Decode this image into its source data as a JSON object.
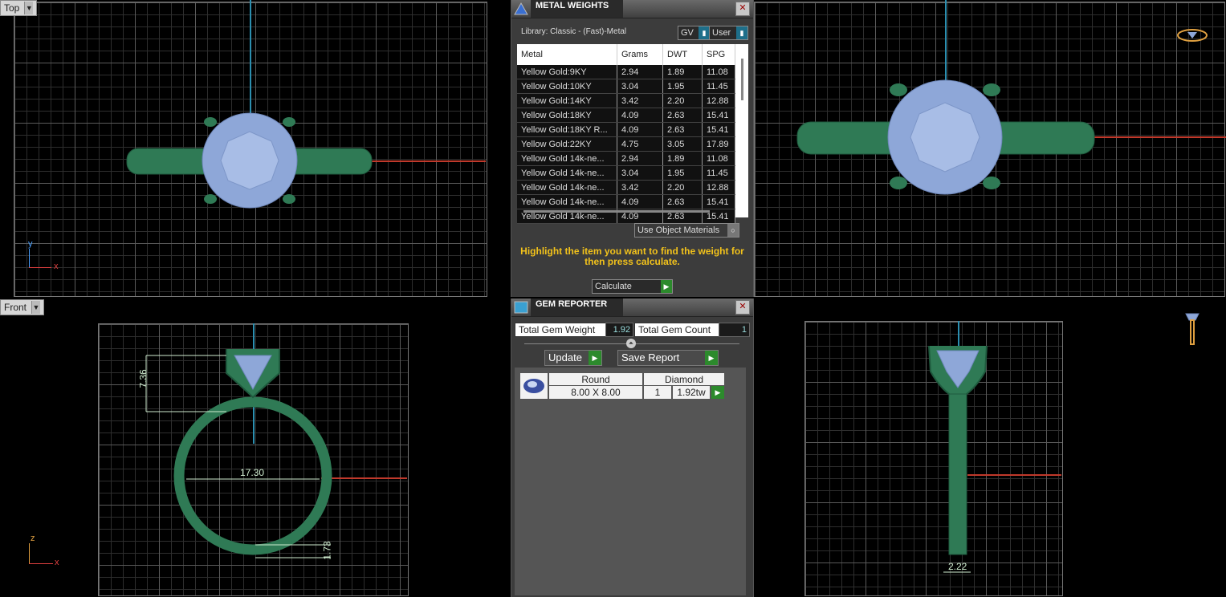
{
  "viewports": {
    "top": {
      "label": "Top",
      "axis_y": "y",
      "axis_x": "x"
    },
    "front": {
      "label": "Front",
      "axis_z": "z",
      "axis_x": "x",
      "dims": {
        "height": "7.36",
        "diameter": "17.30",
        "band": "1.73"
      }
    },
    "side": {
      "dims": {
        "width": "2.22"
      }
    }
  },
  "colors": {
    "metal": "#2f7a55",
    "gem": "#8ea7d8",
    "accent_go": "#2c8a2c",
    "hint": "#f2c21b",
    "axis_blue": "#2c8fb0",
    "axis_red": "#c0392b"
  },
  "metal_weights": {
    "title": "METAL WEIGHTS",
    "library": "Library: Classic - (Fast)-Metal",
    "toggle_gv": "GV",
    "toggle_user": "User",
    "columns": [
      "Metal",
      "Grams",
      "DWT",
      "SPG"
    ],
    "rows": [
      [
        "Yellow Gold:9KY",
        "2.94",
        "1.89",
        "11.08"
      ],
      [
        "Yellow Gold:10KY",
        "3.04",
        "1.95",
        "11.45"
      ],
      [
        "Yellow Gold:14KY",
        "3.42",
        "2.20",
        "12.88"
      ],
      [
        "Yellow Gold:18KY",
        "4.09",
        "2.63",
        "15.41"
      ],
      [
        "Yellow Gold:18KY R...",
        "4.09",
        "2.63",
        "15.41"
      ],
      [
        "Yellow Gold:22KY",
        "4.75",
        "3.05",
        "17.89"
      ],
      [
        "Yellow Gold 14k-ne...",
        "2.94",
        "1.89",
        "11.08"
      ],
      [
        "Yellow Gold 14k-ne...",
        "3.04",
        "1.95",
        "11.45"
      ],
      [
        "Yellow Gold 14k-ne...",
        "3.42",
        "2.20",
        "12.88"
      ],
      [
        "Yellow Gold 14k-ne...",
        "4.09",
        "2.63",
        "15.41"
      ],
      [
        "Yellow Gold 14k-ne...",
        "4.09",
        "2.63",
        "15.41"
      ]
    ],
    "use_object_materials": "Use Object Materials",
    "hint": "Highlight the item you want to find the weight for then press calculate.",
    "calculate": "Calculate"
  },
  "gem_reporter": {
    "title": "GEM REPORTER",
    "total_weight_label": "Total Gem Weight",
    "total_weight": "1.92",
    "total_count_label": "Total Gem Count",
    "total_count": "1",
    "update": "Update",
    "save_report": "Save Report",
    "gem": {
      "shape": "Round",
      "type": "Diamond",
      "size": "8.00 X 8.00",
      "qty": "1",
      "weight": "1.92tw"
    }
  }
}
